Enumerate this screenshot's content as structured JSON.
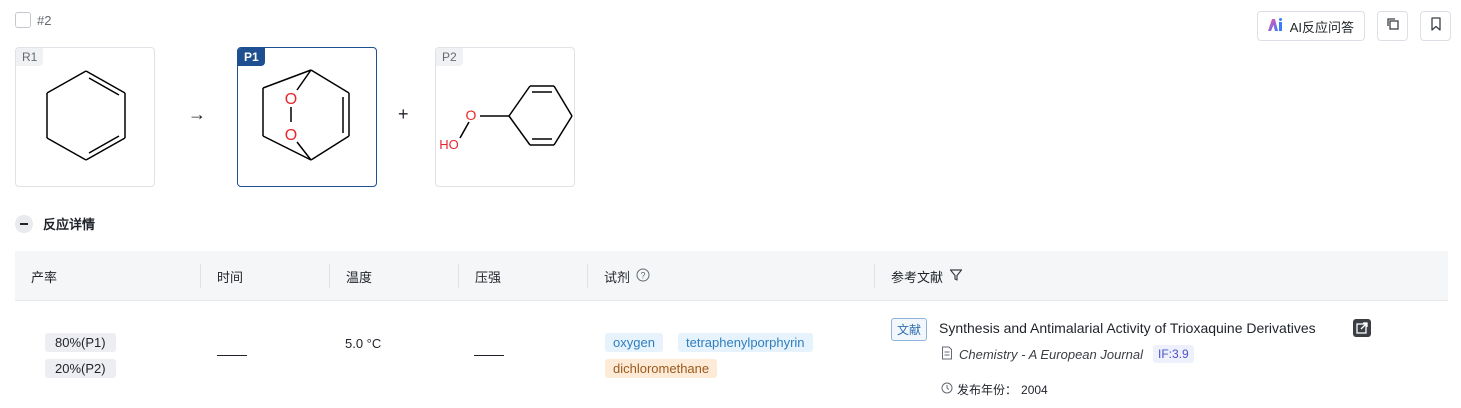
{
  "reaction": {
    "id": "#2"
  },
  "actions": {
    "ai_label": "AI反应问答",
    "copy_icon": "copy-icon",
    "bookmark_icon": "bookmark-icon"
  },
  "molecules": [
    {
      "tag": "R1"
    },
    {
      "tag": "P1"
    },
    {
      "tag": "P2",
      "label_o1": "O",
      "label_ho": "HO"
    }
  ],
  "p1_labels": {
    "o_top": "O",
    "o_bottom": "O"
  },
  "operators": {
    "arrow": "→",
    "plus": "+"
  },
  "section": {
    "title": "反应详情"
  },
  "table": {
    "headers": {
      "yield": "产率",
      "time": "时间",
      "temperature": "温度",
      "pressure": "压强",
      "reagents": "试剂",
      "reference": "参考文献"
    },
    "row": {
      "yields": [
        "80%(P1)",
        "20%(P2)"
      ],
      "temperature": "5.0 °C",
      "reagents": [
        "oxygen",
        "tetraphenylporphyrin",
        "dichloromethane"
      ],
      "reference": {
        "tag": "文献",
        "title": "Synthesis and Antimalarial Activity of Trioxaquine Derivatives",
        "journal": "Chemistry - A European Journal",
        "impact_factor": "IF:3.9",
        "year_label": "发布年份：",
        "year": "2004"
      }
    }
  },
  "colors": {
    "accent": "#1d4f91",
    "oxygen": "#e8262b"
  }
}
